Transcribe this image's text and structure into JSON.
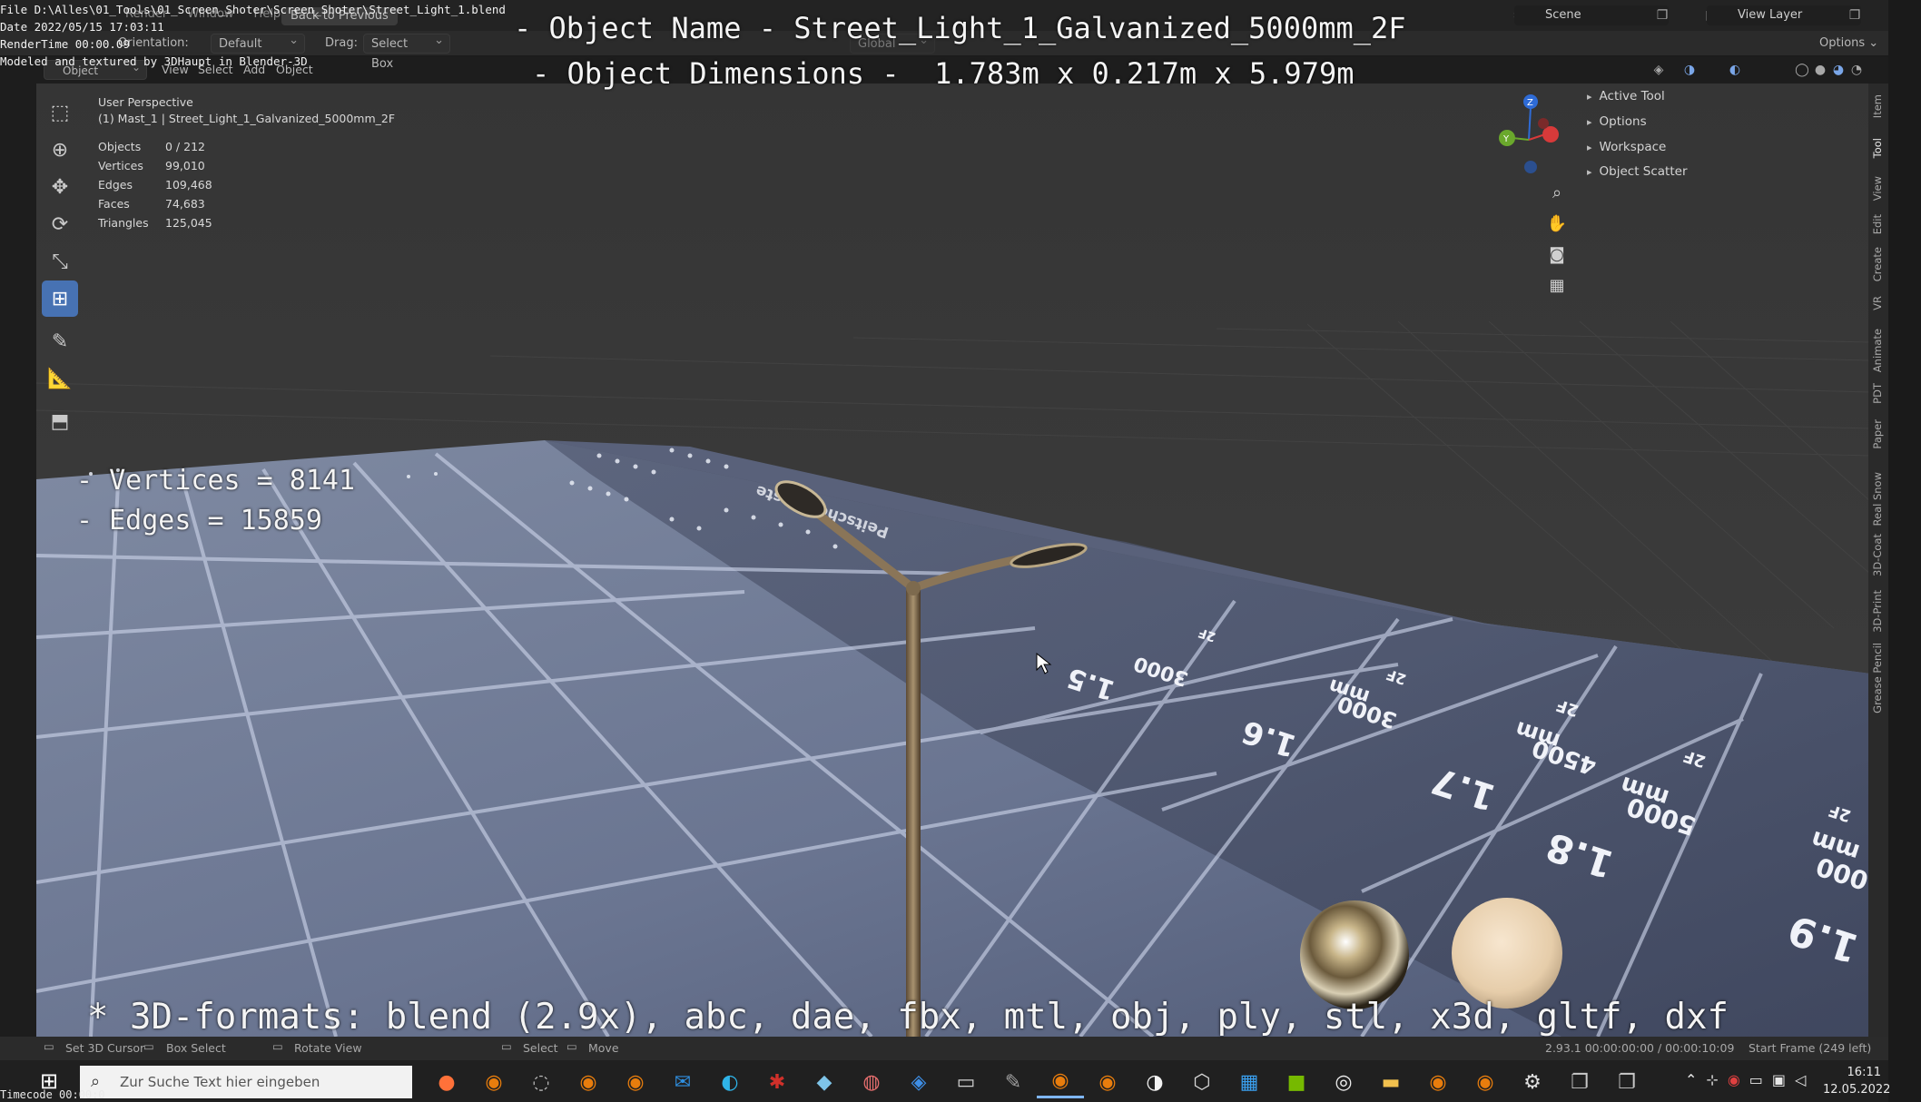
{
  "recording_info": {
    "file_line": "File D:\\Alles\\01_Tools\\01_Screen_Shoter\\Screen_Shoter\\Street_Light_1.blend",
    "date_line": "Date 2022/05/15 17:03:11",
    "rendertime_line": "RenderTime 00:00.09",
    "modeled_line": "Modeled and textured by 3DHaupt in Blender-3D"
  },
  "overlay": {
    "object_name": "- Object Name - Street_Light_1_Galvanized_5000mm_2F",
    "object_dimensions": "- Object Dimensions -  1.783m x 0.217m x 5.979m",
    "vertices": "- Vertices = 8141",
    "edges": "- Edges = 15859",
    "formats": "* 3D-formats: blend (2.9x), abc, dae, fbx, mtl, obj, ply, stl, x3d, gltf, dxf"
  },
  "menubar": {
    "items": [
      "Render",
      "Window",
      "Help"
    ],
    "back_button": "Back to Previous",
    "scene_label": "Scene",
    "view_layer_label": "View Layer"
  },
  "headerbar": {
    "orientation_label": "Orientation:",
    "orientation_value": "Default",
    "drag_label": "Drag:",
    "drag_value": "Select Box",
    "transform_value": "Global",
    "options_label": "Options"
  },
  "viewport_header": {
    "mode": "Object Mode",
    "menus": [
      "View",
      "Select",
      "Add",
      "Object"
    ]
  },
  "viewport_info": {
    "perspective": "User Perspective",
    "collection_object": "(1) Mast_1 | Street_Light_1_Galvanized_5000mm_2F",
    "stats": [
      {
        "key": "Objects",
        "value": "0 / 212"
      },
      {
        "key": "Vertices",
        "value": "99,010"
      },
      {
        "key": "Edges",
        "value": "109,468"
      },
      {
        "key": "Faces",
        "value": "74,683"
      },
      {
        "key": "Triangles",
        "value": "125,045"
      }
    ]
  },
  "toolbar": {
    "tools": [
      {
        "name": "select-tool",
        "icon": "cursor-arrow",
        "active": false
      },
      {
        "name": "cursor-tool",
        "icon": "3d-cursor",
        "active": false
      },
      {
        "name": "move-tool",
        "icon": "move-arrows",
        "active": false
      },
      {
        "name": "rotate-tool",
        "icon": "rotate",
        "active": false
      },
      {
        "name": "scale-tool",
        "icon": "scale",
        "active": false
      },
      {
        "name": "transform-tool",
        "icon": "transform",
        "active": true
      },
      {
        "name": "annotate-tool",
        "icon": "pencil",
        "active": false
      },
      {
        "name": "measure-tool",
        "icon": "ruler",
        "active": false
      },
      {
        "name": "add-cube-tool",
        "icon": "cube-add",
        "active": false
      }
    ]
  },
  "npanel": {
    "sections": [
      "Active Tool",
      "Options",
      "Workspace",
      "Object Scatter"
    ]
  },
  "side_tabs": [
    "Item",
    "Tool",
    "View",
    "Edit",
    "Create",
    "VR",
    "Animate",
    "PDT",
    "Paper",
    "Real Snow",
    "3D-Coat",
    "3D-Print",
    "Grease Pencil"
  ],
  "active_side_tab": "Tool",
  "floor_labels": {
    "strip_text": "Peitschenmaste",
    "rows": [
      {
        "label": "1.5",
        "mm": "3000",
        "unit": "mm",
        "code": "2F"
      },
      {
        "label": "1.6",
        "mm": "3000",
        "unit": "mm",
        "code": "2F"
      },
      {
        "label": "1.7",
        "mm": "4500",
        "unit": "mm",
        "code": "2F"
      },
      {
        "label": "1.8",
        "mm": "5000",
        "unit": "mm",
        "code": "2F"
      },
      {
        "label": "1.9",
        "mm": "000",
        "unit": "mm",
        "code": "2F"
      }
    ]
  },
  "statusbar": {
    "set_cursor": "Set 3D Cursor",
    "box_select": "Box Select",
    "rotate_view": "Rotate View",
    "select": "Select",
    "move": "Move",
    "version_time": "2.93.1   00:00:00:00 / 00:00:10:09",
    "start_frame": "Start Frame (249 left)"
  },
  "taskbar": {
    "search_placeholder": "Zur Suche Text hier eingeben",
    "time": "16:11",
    "date": "12.05.2022",
    "apps": [
      {
        "name": "firefox",
        "color": "#ff7139",
        "glyph": "●"
      },
      {
        "name": "blender",
        "color": "#e87d0d",
        "glyph": "◉"
      },
      {
        "name": "app-circle",
        "color": "#bbbbbb",
        "glyph": "◌"
      },
      {
        "name": "blender",
        "color": "#e87d0d",
        "glyph": "◉"
      },
      {
        "name": "blender",
        "color": "#e87d0d",
        "glyph": "◉"
      },
      {
        "name": "mail",
        "color": "#2f8fe0",
        "glyph": "✉"
      },
      {
        "name": "edge",
        "color": "#2fb4e8",
        "glyph": "◐"
      },
      {
        "name": "app-red",
        "color": "#d0302a",
        "glyph": "✱"
      },
      {
        "name": "app-cube",
        "color": "#7ec4e8",
        "glyph": "◆"
      },
      {
        "name": "app-paint",
        "color": "#e86f6f",
        "glyph": "◍"
      },
      {
        "name": "app-blue",
        "color": "#3e8ee6",
        "glyph": "◈"
      },
      {
        "name": "terminal",
        "color": "#cfcfcf",
        "glyph": "▭"
      },
      {
        "name": "app-tool",
        "color": "#a0a0a0",
        "glyph": "✎"
      },
      {
        "name": "blender-active",
        "color": "#e87d0d",
        "glyph": "◉"
      },
      {
        "name": "blender",
        "color": "#e87d0d",
        "glyph": "◉"
      },
      {
        "name": "panda",
        "color": "#f2f2f2",
        "glyph": "◑"
      },
      {
        "name": "cube-app",
        "color": "#dadada",
        "glyph": "⬡"
      },
      {
        "name": "calendar",
        "color": "#3aa0f0",
        "glyph": "▦"
      },
      {
        "name": "nvidia",
        "color": "#76b900",
        "glyph": "■"
      },
      {
        "name": "obs",
        "color": "#eeeeee",
        "glyph": "◎"
      },
      {
        "name": "folder",
        "color": "#f2c14e",
        "glyph": "▬"
      },
      {
        "name": "blender",
        "color": "#e87d0d",
        "glyph": "◉"
      },
      {
        "name": "blender",
        "color": "#e87d0d",
        "glyph": "◉"
      },
      {
        "name": "settings",
        "color": "#e0e0e0",
        "glyph": "⚙"
      },
      {
        "name": "app-window",
        "color": "#c8c8c8",
        "glyph": "❐"
      },
      {
        "name": "app-window",
        "color": "#c8c8c8",
        "glyph": "❐"
      }
    ],
    "active_app_index": 13
  },
  "timecode": "Timecode 00:00:0"
}
